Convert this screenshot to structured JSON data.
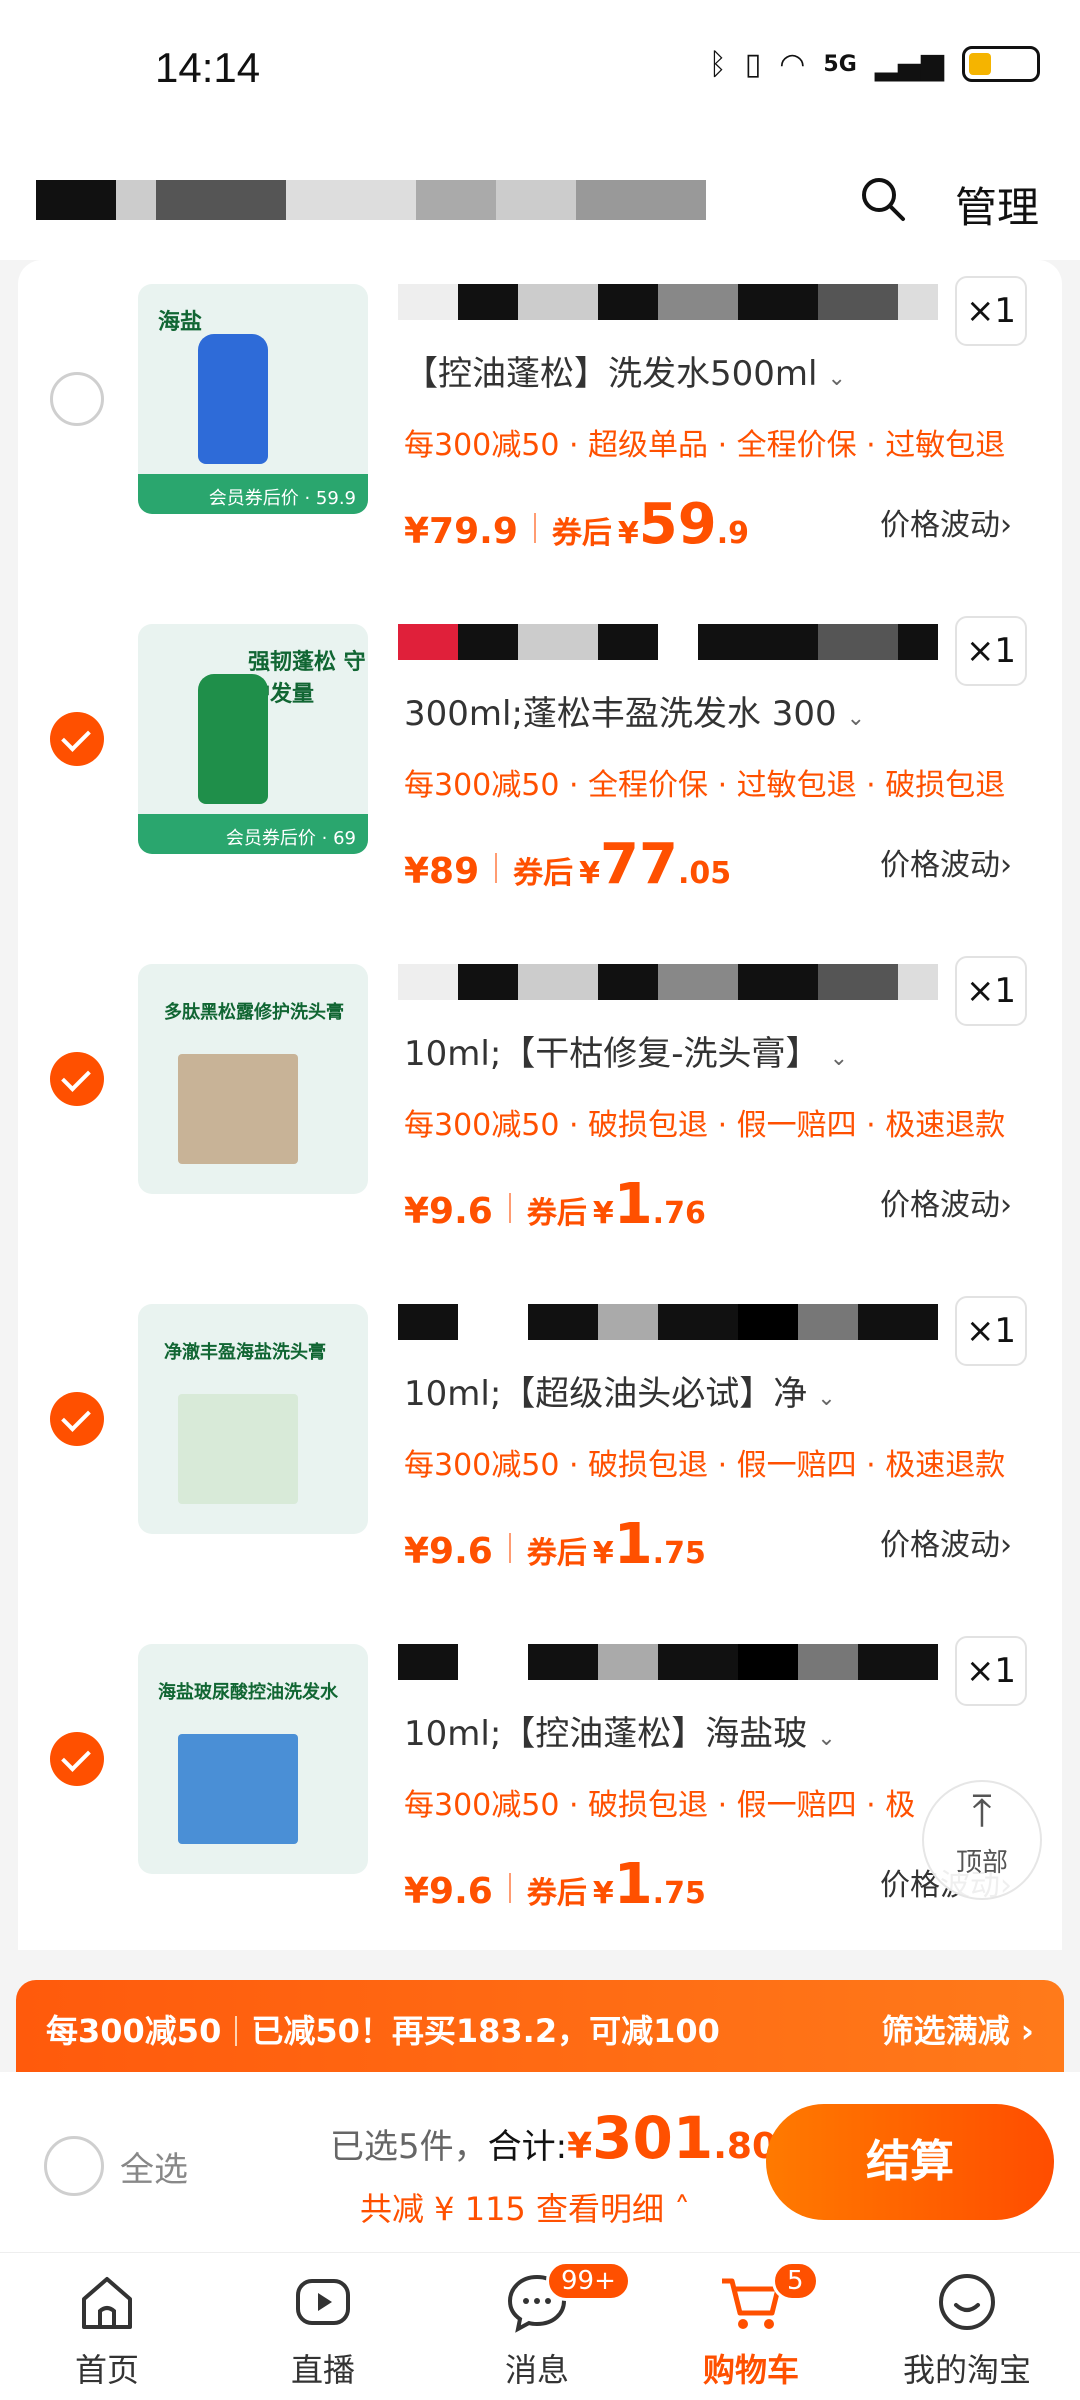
{
  "status_bar": {
    "time": "14:14",
    "network": "5G"
  },
  "header": {
    "manage_label": "管理"
  },
  "items": [
    {
      "spec": "【控油蓬松】洗发水500ml",
      "promo": "每300减50 · 超级单品 · 全程价保 · 过敏包退",
      "price": "¥79.9",
      "after_label": "券后",
      "after_yen": "¥",
      "after_int": "59",
      "after_dec": ".9",
      "qty": "×1",
      "fluct": "价格波动",
      "checked": false
    },
    {
      "spec": "300ml;蓬松丰盈洗发水 300",
      "promo": "每300减50 · 全程价保 · 过敏包退 · 破损包退",
      "price": "¥89",
      "after_label": "券后",
      "after_yen": "¥",
      "after_int": "77",
      "after_dec": ".05",
      "qty": "×1",
      "fluct": "价格波动",
      "checked": true
    },
    {
      "spec": "10ml;【干枯修复-洗头膏】",
      "promo": "每300减50 · 破损包退 · 假一赔四 · 极速退款",
      "price": "¥9.6",
      "after_label": "券后",
      "after_yen": "¥",
      "after_int": "1",
      "after_dec": ".76",
      "qty": "×1",
      "fluct": "价格波动",
      "checked": true
    },
    {
      "spec": "10ml;【超级油头必试】净",
      "promo": "每300减50 · 破损包退 · 假一赔四 · 极速退款",
      "price": "¥9.6",
      "after_label": "券后",
      "after_yen": "¥",
      "after_int": "1",
      "after_dec": ".75",
      "qty": "×1",
      "fluct": "价格波动",
      "checked": true
    },
    {
      "spec": "10ml;【控油蓬松】海盐玻",
      "promo": "每300减50 · 破损包退 · 假一赔四 · 极",
      "price": "¥9.6",
      "after_label": "券后",
      "after_yen": "¥",
      "after_int": "1",
      "after_dec": ".75",
      "qty": "×1",
      "fluct": "价格波动",
      "checked": true
    }
  ],
  "thumb_titles": [
    "海盐",
    "强韧蓬松 守护发量",
    "多肽黑松露修护洗头膏",
    "净澈丰盈海盐洗头膏",
    "海盐玻尿酸控油洗发水"
  ],
  "thumb_bands": [
    "会员券后价 · 59.9",
    "会员券后价 · 69",
    "",
    "",
    ""
  ],
  "back_top_label": "顶部",
  "promo_bar": {
    "left1": "每300减50",
    "left2": "已减50！再买183.2，可减100",
    "right": "筛选满减 ›"
  },
  "checkout": {
    "select_all": "全选",
    "selected": "已选5件，",
    "total_label": "合计:",
    "total_yen": "¥",
    "total_int": "301",
    "total_dec": ".80",
    "savings": "共减 ¥ 115  查看明细 ˄",
    "button": "结算"
  },
  "tabs": [
    {
      "label": "首页",
      "icon": "home-icon"
    },
    {
      "label": "直播",
      "icon": "live-icon"
    },
    {
      "label": "消息",
      "icon": "message-icon",
      "badge": "99+"
    },
    {
      "label": "购物车",
      "icon": "cart-icon",
      "badge": "5",
      "active": true
    },
    {
      "label": "我的淘宝",
      "icon": "profile-icon"
    }
  ],
  "colors": {
    "accent": "#ff5000"
  }
}
